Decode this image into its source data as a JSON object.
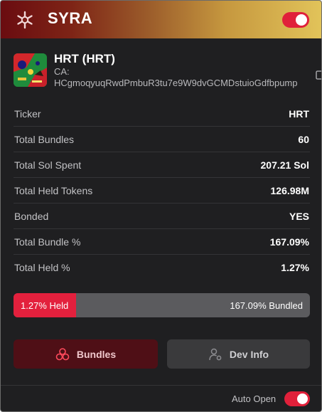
{
  "header": {
    "brand": "SYRA",
    "toggle_on": true,
    "accent": "#e0203a"
  },
  "token": {
    "name": "HRT (HRT)",
    "ca_label": "CA:",
    "ca_value": "HCgmoqyuqRwdPmbuR3tu7e9W9dvGCMDstuioGdfbpump"
  },
  "stats": [
    {
      "label": "Ticker",
      "value": "HRT"
    },
    {
      "label": "Total Bundles",
      "value": "60"
    },
    {
      "label": "Total Sol Spent",
      "value": "207.21 Sol"
    },
    {
      "label": "Total Held Tokens",
      "value": "126.98M"
    },
    {
      "label": "Bonded",
      "value": "YES"
    },
    {
      "label": "Total Bundle %",
      "value": "167.09%"
    },
    {
      "label": "Total Held %",
      "value": "1.27%"
    }
  ],
  "progress": {
    "held_label": "1.27% Held",
    "bundled_label": "167.09% Bundled"
  },
  "buttons": {
    "bundles": "Bundles",
    "dev_info": "Dev Info"
  },
  "footer": {
    "auto_open_label": "Auto Open",
    "auto_open_on": true
  }
}
